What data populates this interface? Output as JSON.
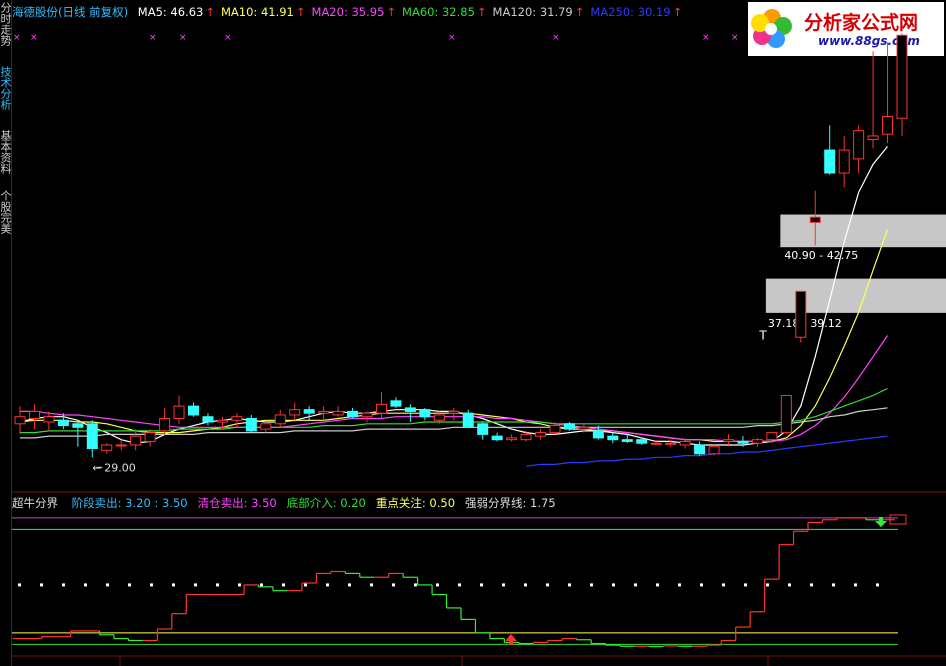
{
  "header": {
    "stock": "海德股份(日线 前复权)",
    "ma_items": [
      {
        "label": "MA5: 46.63",
        "color": "#ffffff"
      },
      {
        "label": "MA10: 41.91",
        "color": "#ffff55"
      },
      {
        "label": "MA20: 35.95",
        "color": "#ff44ff"
      },
      {
        "label": "MA60: 32.85",
        "color": "#33dd33"
      },
      {
        "label": "MA120: 31.79",
        "color": "#cccccc"
      },
      {
        "label": "MA250: 30.19",
        "color": "#2a3aff"
      }
    ],
    "arrow": "↑",
    "arrow_color": "#ff3333"
  },
  "sidebar": {
    "tabs": [
      {
        "label": "分时走势",
        "color": "#cfcfcf"
      },
      {
        "label": "技术分析",
        "color": "#33bbff"
      },
      {
        "label": "基本资料",
        "color": "#cfcfcf"
      },
      {
        "label": "个股完美",
        "color": "#cfcfcf"
      }
    ]
  },
  "logo": {
    "text": "分析家公式网",
    "url": "www.88gs.com"
  },
  "indicator": {
    "name": "超牛分界",
    "items": [
      {
        "label": "阶段卖出: 3.20 : 3.50",
        "color": "#33bbff"
      },
      {
        "label": "清仓卖出: 3.50",
        "color": "#ff44ff"
      },
      {
        "label": "底部介入: 0.20",
        "color": "#33dd33"
      },
      {
        "label": "重点关注: 0.50",
        "color": "#ffff55"
      },
      {
        "label": "强弱分界线: 1.75",
        "color": "#dddddd"
      }
    ],
    "level_colors": {
      "sell_stage": "#33cccc",
      "sell_clear": "#dd33dd",
      "bottom": "#33dd33",
      "focus": "#ffff55"
    }
  },
  "chart_data": {
    "type": "candlestick",
    "candles": [
      {
        "o": 30.9,
        "h": 31.9,
        "l": 30.3,
        "c": 31.3
      },
      {
        "o": 31.2,
        "h": 32.0,
        "l": 30.6,
        "c": 31.6
      },
      {
        "o": 31.0,
        "h": 31.6,
        "l": 30.5,
        "c": 31.3
      },
      {
        "o": 31.1,
        "h": 31.5,
        "l": 30.6,
        "c": 30.8
      },
      {
        "o": 30.9,
        "h": 31.1,
        "l": 29.6,
        "c": 30.7
      },
      {
        "o": 30.9,
        "h": 31.1,
        "l": 29.0,
        "c": 29.5
      },
      {
        "o": 29.4,
        "h": 29.8,
        "l": 29.2,
        "c": 29.7
      },
      {
        "o": 29.7,
        "h": 30.0,
        "l": 29.4,
        "c": 29.7
      },
      {
        "o": 29.7,
        "h": 30.6,
        "l": 29.4,
        "c": 30.2
      },
      {
        "o": 29.9,
        "h": 30.6,
        "l": 29.6,
        "c": 30.4
      },
      {
        "o": 30.5,
        "h": 31.8,
        "l": 30.3,
        "c": 31.2
      },
      {
        "o": 31.2,
        "h": 32.5,
        "l": 30.9,
        "c": 31.9
      },
      {
        "o": 31.9,
        "h": 32.1,
        "l": 31.3,
        "c": 31.4
      },
      {
        "o": 31.3,
        "h": 31.5,
        "l": 30.8,
        "c": 31.0
      },
      {
        "o": 31.0,
        "h": 31.3,
        "l": 30.6,
        "c": 31.1
      },
      {
        "o": 31.1,
        "h": 31.5,
        "l": 30.7,
        "c": 31.3
      },
      {
        "o": 31.2,
        "h": 31.4,
        "l": 30.4,
        "c": 30.5
      },
      {
        "o": 30.6,
        "h": 31.0,
        "l": 30.4,
        "c": 30.9
      },
      {
        "o": 30.9,
        "h": 31.7,
        "l": 30.7,
        "c": 31.4
      },
      {
        "o": 31.4,
        "h": 32.1,
        "l": 31.0,
        "c": 31.7
      },
      {
        "o": 31.7,
        "h": 31.9,
        "l": 31.1,
        "c": 31.5
      },
      {
        "o": 31.5,
        "h": 31.9,
        "l": 31.0,
        "c": 31.6
      },
      {
        "o": 31.4,
        "h": 31.9,
        "l": 31.3,
        "c": 31.6
      },
      {
        "o": 31.6,
        "h": 31.8,
        "l": 31.2,
        "c": 31.3
      },
      {
        "o": 31.3,
        "h": 31.6,
        "l": 31.0,
        "c": 31.5
      },
      {
        "o": 31.5,
        "h": 32.7,
        "l": 31.2,
        "c": 32.0
      },
      {
        "o": 32.2,
        "h": 32.4,
        "l": 31.8,
        "c": 31.9
      },
      {
        "o": 31.8,
        "h": 32.0,
        "l": 31.0,
        "c": 31.6
      },
      {
        "o": 31.7,
        "h": 31.8,
        "l": 31.1,
        "c": 31.3
      },
      {
        "o": 31.1,
        "h": 31.6,
        "l": 30.9,
        "c": 31.4
      },
      {
        "o": 31.5,
        "h": 31.8,
        "l": 31.1,
        "c": 31.6
      },
      {
        "o": 31.5,
        "h": 31.7,
        "l": 30.8,
        "c": 30.7
      },
      {
        "o": 30.9,
        "h": 31.0,
        "l": 30.0,
        "c": 30.3
      },
      {
        "o": 30.2,
        "h": 30.4,
        "l": 29.9,
        "c": 30.0
      },
      {
        "o": 30.0,
        "h": 30.3,
        "l": 29.9,
        "c": 30.1
      },
      {
        "o": 30.0,
        "h": 30.5,
        "l": 29.9,
        "c": 30.3
      },
      {
        "o": 30.2,
        "h": 30.6,
        "l": 30.0,
        "c": 30.4
      },
      {
        "o": 30.4,
        "h": 31.0,
        "l": 30.3,
        "c": 30.8
      },
      {
        "o": 30.9,
        "h": 31.0,
        "l": 30.5,
        "c": 30.6
      },
      {
        "o": 30.6,
        "h": 30.9,
        "l": 30.4,
        "c": 30.7
      },
      {
        "o": 30.5,
        "h": 30.8,
        "l": 30.0,
        "c": 30.1
      },
      {
        "o": 30.2,
        "h": 30.4,
        "l": 29.8,
        "c": 30.0
      },
      {
        "o": 30.0,
        "h": 30.3,
        "l": 29.8,
        "c": 29.9
      },
      {
        "o": 30.0,
        "h": 30.1,
        "l": 29.7,
        "c": 29.8
      },
      {
        "o": 29.8,
        "h": 30.0,
        "l": 29.7,
        "c": 29.8
      },
      {
        "o": 29.8,
        "h": 30.0,
        "l": 29.6,
        "c": 29.8
      },
      {
        "o": 29.7,
        "h": 30.1,
        "l": 29.5,
        "c": 29.9
      },
      {
        "o": 29.7,
        "h": 29.9,
        "l": 29.1,
        "c": 29.2
      },
      {
        "o": 29.2,
        "h": 29.7,
        "l": 29.1,
        "c": 29.6
      },
      {
        "o": 29.9,
        "h": 30.3,
        "l": 29.7,
        "c": 30.0
      },
      {
        "o": 29.9,
        "h": 30.2,
        "l": 29.6,
        "c": 29.8
      },
      {
        "o": 29.8,
        "h": 30.1,
        "l": 29.6,
        "c": 30.0
      },
      {
        "o": 30.0,
        "h": 30.3,
        "l": 29.8,
        "c": 30.4
      },
      {
        "o": 30.4,
        "h": 32.5,
        "l": 30.3,
        "c": 32.5
      },
      {
        "o": 35.8,
        "h": 38.4,
        "l": 35.5,
        "c": 38.4
      },
      {
        "o": 42.3,
        "h": 44.1,
        "l": 41.0,
        "c": 42.6
      },
      {
        "o": 46.4,
        "h": 47.8,
        "l": 45.0,
        "c": 45.1
      },
      {
        "o": 45.1,
        "h": 47.2,
        "l": 44.3,
        "c": 46.4
      },
      {
        "o": 45.9,
        "h": 47.8,
        "l": 45.1,
        "c": 47.5
      },
      {
        "o": 47.0,
        "h": 52.0,
        "l": 46.5,
        "c": 47.2
      },
      {
        "o": 47.3,
        "h": 52.5,
        "l": 46.8,
        "c": 48.3
      },
      {
        "o": 48.2,
        "h": 53.0,
        "l": 47.2,
        "c": 52.9
      }
    ],
    "moving_averages": [
      {
        "name": "MA5",
        "color": "#ffffff",
        "values": [
          31.0,
          31.2,
          31.3,
          31.3,
          31.1,
          30.7,
          30.4,
          30.0,
          29.8,
          29.9,
          30.3,
          30.6,
          30.8,
          31.0,
          31.1,
          31.2,
          31.1,
          31.0,
          31.0,
          31.1,
          31.3,
          31.5,
          31.6,
          31.5,
          31.5,
          31.6,
          31.7,
          31.7,
          31.7,
          31.6,
          31.6,
          31.4,
          31.2,
          30.9,
          30.6,
          30.4,
          30.3,
          30.3,
          30.4,
          30.5,
          30.5,
          30.4,
          30.3,
          30.1,
          29.9,
          29.9,
          29.8,
          29.7,
          29.7,
          29.7,
          29.7,
          29.8,
          29.9,
          30.5,
          31.9,
          34.7,
          37.9,
          41.2,
          44.0,
          45.6,
          46.6
        ]
      },
      {
        "name": "MA10",
        "color": "#ffff55",
        "values": [
          31.0,
          31.1,
          31.1,
          31.1,
          31.0,
          31.0,
          30.9,
          30.7,
          30.5,
          30.4,
          30.4,
          30.4,
          30.5,
          30.6,
          30.7,
          30.9,
          31.0,
          31.1,
          31.1,
          31.1,
          31.1,
          31.1,
          31.2,
          31.3,
          31.4,
          31.5,
          31.5,
          31.5,
          31.5,
          31.5,
          31.5,
          31.5,
          31.4,
          31.3,
          31.2,
          31.0,
          30.9,
          30.7,
          30.6,
          30.6,
          30.5,
          30.5,
          30.4,
          30.3,
          30.2,
          30.1,
          30.0,
          30.0,
          29.9,
          29.9,
          29.9,
          29.9,
          29.9,
          30.1,
          30.8,
          31.9,
          33.5,
          35.3,
          37.2,
          39.6,
          41.9
        ]
      },
      {
        "name": "MA20",
        "color": "#ff44ff",
        "values": [
          31.6,
          31.6,
          31.5,
          31.4,
          31.4,
          31.3,
          31.2,
          31.1,
          31.0,
          30.9,
          30.8,
          30.7,
          30.7,
          30.7,
          30.7,
          30.7,
          30.7,
          30.7,
          30.7,
          30.8,
          30.9,
          31.0,
          31.1,
          31.2,
          31.2,
          31.2,
          31.3,
          31.3,
          31.3,
          31.3,
          31.3,
          31.3,
          31.3,
          31.2,
          31.2,
          31.1,
          31.0,
          30.9,
          30.8,
          30.7,
          30.6,
          30.5,
          30.4,
          30.3,
          30.2,
          30.1,
          30.0,
          30.0,
          30.0,
          29.9,
          29.9,
          29.9,
          29.9,
          30.0,
          30.3,
          30.8,
          31.5,
          32.4,
          33.5,
          34.7,
          35.9
        ]
      },
      {
        "name": "MA60",
        "color": "#33dd33",
        "values": [
          30.4,
          30.4,
          30.5,
          30.5,
          30.5,
          30.5,
          30.5,
          30.5,
          30.5,
          30.5,
          30.5,
          30.6,
          30.6,
          30.6,
          30.6,
          30.7,
          30.7,
          30.7,
          30.7,
          30.7,
          30.7,
          30.8,
          30.8,
          30.8,
          30.9,
          30.9,
          30.9,
          30.9,
          31.0,
          31.0,
          31.0,
          31.0,
          31.0,
          31.0,
          31.0,
          31.0,
          31.0,
          30.9,
          30.9,
          30.9,
          30.9,
          30.9,
          30.9,
          30.9,
          30.9,
          30.9,
          30.9,
          30.9,
          30.9,
          30.9,
          30.9,
          30.9,
          30.9,
          31.0,
          31.1,
          31.3,
          31.6,
          31.9,
          32.2,
          32.5,
          32.9
        ]
      },
      {
        "name": "MA120",
        "color": "#cccccc",
        "values": [
          30.1,
          30.1,
          30.2,
          30.2,
          30.2,
          30.2,
          30.3,
          30.3,
          30.3,
          30.3,
          30.3,
          30.3,
          30.3,
          30.4,
          30.4,
          30.4,
          30.4,
          30.4,
          30.4,
          30.5,
          30.5,
          30.5,
          30.5,
          30.5,
          30.6,
          30.6,
          30.6,
          30.6,
          30.6,
          30.6,
          30.7,
          30.7,
          30.7,
          30.7,
          30.7,
          30.7,
          30.7,
          30.7,
          30.7,
          30.7,
          30.7,
          30.7,
          30.7,
          30.7,
          30.7,
          30.7,
          30.7,
          30.7,
          30.7,
          30.7,
          30.7,
          30.8,
          30.8,
          30.9,
          31.0,
          31.1,
          31.3,
          31.4,
          31.6,
          31.7,
          31.8
        ]
      },
      {
        "name": "MA250",
        "color": "#2a3aff",
        "values": [
          null,
          null,
          null,
          null,
          null,
          null,
          null,
          null,
          null,
          null,
          null,
          null,
          null,
          null,
          null,
          null,
          null,
          null,
          null,
          null,
          null,
          null,
          null,
          null,
          null,
          null,
          null,
          null,
          null,
          null,
          null,
          null,
          null,
          null,
          null,
          28.5,
          28.6,
          28.6,
          28.7,
          28.7,
          28.8,
          28.8,
          28.9,
          28.9,
          29.0,
          29.0,
          29.1,
          29.1,
          29.2,
          29.2,
          29.3,
          29.3,
          29.4,
          29.5,
          29.6,
          29.7,
          29.8,
          29.9,
          30.0,
          30.1,
          30.2
        ]
      }
    ],
    "zones": [
      {
        "label": "40.90 - 42.75",
        "low": 40.9,
        "high": 42.75
      },
      {
        "label": "37.18 - 39.12",
        "low": 37.18,
        "high": 39.12
      }
    ],
    "low_annotation": {
      "label": "29.00",
      "index": 5,
      "value": 29.0
    },
    "indicator_values": [
      0.35,
      0.35,
      0.4,
      0.4,
      0.55,
      0.55,
      0.45,
      0.35,
      0.3,
      0.3,
      0.6,
      1.0,
      1.5,
      1.5,
      1.5,
      1.5,
      1.75,
      1.7,
      1.6,
      1.6,
      1.8,
      2.05,
      2.1,
      2.05,
      1.95,
      1.95,
      2.05,
      1.95,
      1.75,
      1.5,
      1.15,
      0.85,
      0.5,
      0.35,
      0.25,
      0.22,
      0.25,
      0.3,
      0.35,
      0.32,
      0.22,
      0.18,
      0.15,
      0.15,
      0.14,
      0.16,
      0.15,
      0.15,
      0.18,
      0.3,
      0.65,
      1.05,
      1.9,
      2.8,
      3.15,
      3.38,
      3.45,
      3.5,
      3.5,
      3.45,
      3.45
    ],
    "indicator_ylim": [
      0,
      3.6
    ]
  }
}
